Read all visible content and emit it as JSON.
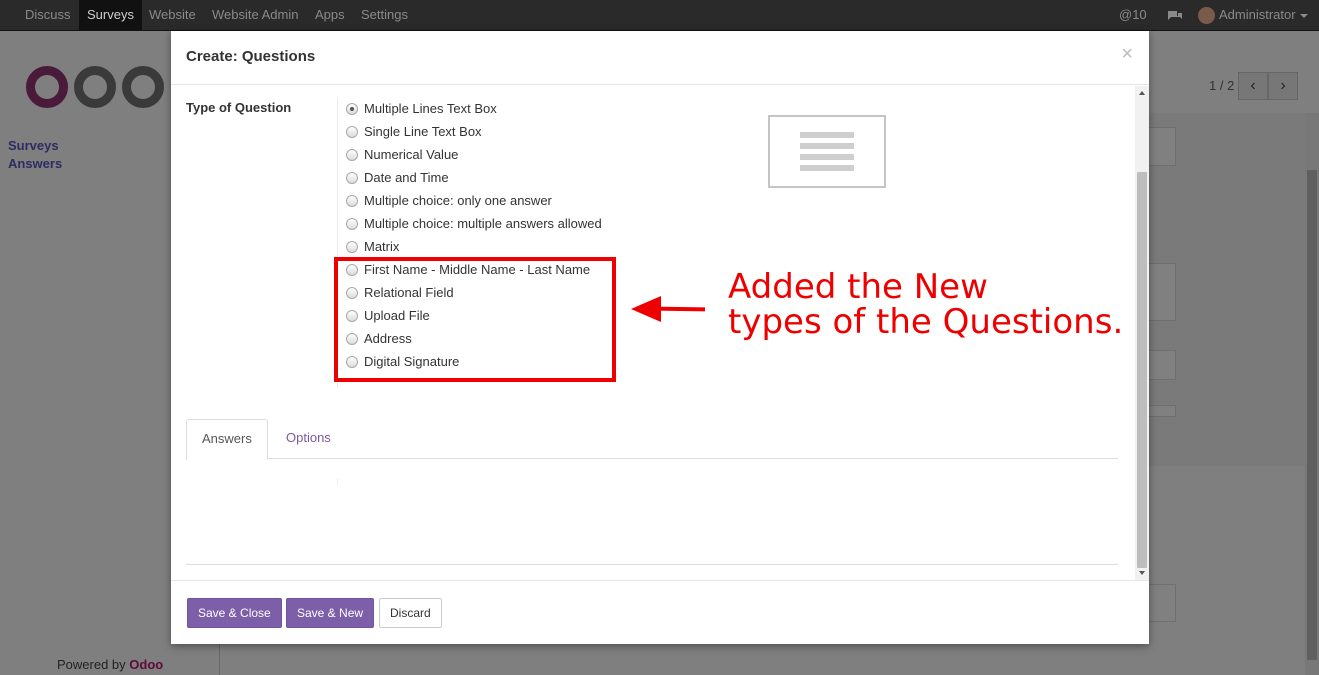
{
  "navbar": {
    "items": [
      "Discuss",
      "Surveys",
      "Website",
      "Website Admin",
      "Apps",
      "Settings"
    ],
    "active": "Surveys",
    "notifications": "10",
    "user": "Administrator"
  },
  "background": {
    "sidebar_links": [
      "Surveys",
      "Answers"
    ],
    "powered_by_prefix": "Powered by",
    "powered_by_brand": "Odoo",
    "pager": "1 / 2"
  },
  "modal": {
    "title": "Create: Questions",
    "close_symbol": "×",
    "field_label": "Type of Question",
    "question_types": [
      {
        "label": "Multiple Lines Text Box",
        "checked": true
      },
      {
        "label": "Single Line Text Box",
        "checked": false
      },
      {
        "label": "Numerical Value",
        "checked": false
      },
      {
        "label": "Date and Time",
        "checked": false
      },
      {
        "label": "Multiple choice: only one answer",
        "checked": false
      },
      {
        "label": "Multiple choice: multiple answers allowed",
        "checked": false
      },
      {
        "label": "Matrix",
        "checked": false
      },
      {
        "label": "First Name - Middle Name - Last Name",
        "checked": false
      },
      {
        "label": "Relational Field",
        "checked": false
      },
      {
        "label": "Upload File",
        "checked": false
      },
      {
        "label": "Address",
        "checked": false
      },
      {
        "label": "Digital Signature",
        "checked": false
      }
    ],
    "tabs": [
      {
        "label": "Answers",
        "active": true
      },
      {
        "label": "Options",
        "active": false
      }
    ],
    "buttons": {
      "save_close": "Save & Close",
      "save_new": "Save & New",
      "discard": "Discard"
    }
  },
  "annotation": {
    "line1": "Added the New",
    "line2": "types of the Questions.",
    "color": "#ee0000"
  },
  "colors": {
    "primary": "#7c5fa8",
    "navbar": "#2a2a2a",
    "link": "#7c5a9a"
  }
}
